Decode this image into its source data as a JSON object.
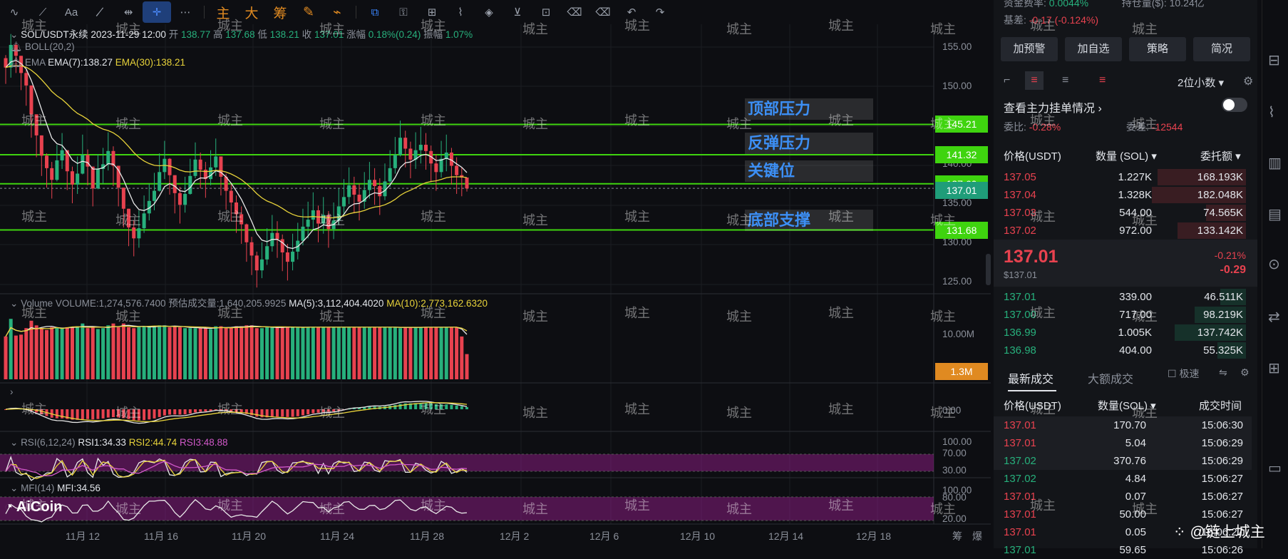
{
  "toolbar": {
    "tools": [
      "∿",
      "⟋",
      "Aa",
      "⟋̸",
      "⇹",
      "✛",
      "⋯"
    ],
    "main_tabs": [
      "主",
      "大",
      "筹"
    ],
    "right_tools": [
      "✎",
      "⌁",
      "⧉",
      "⚿",
      "⊞",
      "⌇",
      "◈",
      "⊻",
      "⊡",
      "⌫",
      "↶",
      "↷"
    ]
  },
  "info": {
    "symbol_line": "SOL/USDT永续 2023-11-29 12:00",
    "open_label": "开",
    "open": "138.77",
    "high_label": "高",
    "high": "137.68",
    "low_label": "低",
    "low": "138.21",
    "close_label": "收",
    "close": "137.01",
    "change_label": "涨幅",
    "change": "0.18%(0.24)",
    "amp_label": "振幅",
    "amp": "1.07%",
    "boll": "BOLL(20,2)",
    "ema_name": "EMA",
    "ema7": "EMA(7):138.27",
    "ema30": "EMA(30):138.21",
    "volume_name": "Volume",
    "volume": "VOLUME:1,274,576.7400",
    "est_volume": "预估成交量:1,640,205.9925",
    "ma5": "MA(5):3,112,404.4020",
    "ma10": "MA(10):2,773,162.6320",
    "rsi_name": "RSI(6,12,24)",
    "rsi1": "RSI1:34.33",
    "rsi2": "RSI2:44.74",
    "rsi3": "RSI3:48.88",
    "mfi_name": "MFI(14)",
    "mfi": "MFI:34.56"
  },
  "annotations": [
    {
      "label": "顶部压力",
      "price": "145.21"
    },
    {
      "label": "反弹压力",
      "price": "141.32"
    },
    {
      "label": "关键位",
      "price": "137.60"
    },
    {
      "label": "底部支撑",
      "price": "131.68"
    }
  ],
  "current_price_tag": "137.01",
  "volume_tag": "1.3M",
  "price_axis": [
    "155.00",
    "150.00",
    "145.00",
    "140.00",
    "135.00",
    "130.00",
    "125.00"
  ],
  "volume_axis": [
    "10.00M"
  ],
  "macd_axis": [
    "0.00"
  ],
  "rsi_axis": [
    "100.00",
    "70.00",
    "30.00"
  ],
  "mfi_axis": [
    "100.00",
    "80.00",
    "20.00"
  ],
  "date_axis": [
    "11月 12",
    "11月 16",
    "11月 20",
    "11月 24",
    "11月 28",
    "12月 2",
    "12月 6",
    "12月 10",
    "12月 14",
    "12月 18"
  ],
  "bottom_right": [
    "筹",
    "爆"
  ],
  "logo": "AiCoin",
  "watermark_text": "城主",
  "signature": "@链上城主",
  "colors": {
    "up": "#27b07c",
    "down": "#e8424f",
    "level_line": "#3fd40f",
    "ema30": "#e8d33a",
    "ema7": "#e9e9e9",
    "annotation": "#3c8ff5"
  },
  "chart_data": {
    "type": "candlestick",
    "symbol": "SOL/USDT永续",
    "interval_hint": "4h",
    "ylim": [
      123.5,
      157.5
    ],
    "dates": [
      "11月 12",
      "11月 16",
      "11月 20",
      "11月 24",
      "11月 28"
    ],
    "levels": [
      145.21,
      141.32,
      137.6,
      131.68
    ],
    "closes": [
      152.5,
      155.4,
      154.0,
      151.8,
      150.2,
      146.5,
      143.8,
      141.2,
      139.6,
      138.1,
      140.6,
      141.9,
      139.2,
      137.5,
      138.9,
      141.3,
      139.8,
      137.0,
      139.5,
      140.1,
      141.8,
      139.9,
      137.1,
      134.4,
      132.0,
      130.6,
      131.9,
      133.8,
      135.4,
      136.7,
      139.1,
      140.8,
      138.7,
      136.4,
      134.9,
      136.3,
      138.6,
      140.7,
      139.4,
      138.2,
      139.7,
      141.1,
      138.5,
      136.7,
      135.2,
      133.7,
      132.4,
      130.1,
      128.4,
      126.5,
      127.9,
      129.6,
      131.3,
      130.5,
      128.8,
      127.6,
      128.9,
      130.3,
      132.1,
      133.0,
      134.2,
      132.5,
      133.6,
      131.8,
      132.9,
      134.7,
      135.9,
      137.4,
      136.2,
      135.3,
      136.8,
      138.1,
      137.3,
      136.0,
      137.9,
      139.6,
      141.3,
      143.5,
      142.1,
      140.7,
      141.9,
      142.6,
      141.8,
      140.2,
      139.1,
      140.8,
      141.6,
      139.9,
      138.7,
      138.4,
      137.0
    ],
    "highs": [
      154.1,
      156.8,
      155.6,
      153.5,
      152.2,
      148.9,
      145.9,
      143.2,
      141.5,
      140.4,
      142.6,
      144.1,
      141.5,
      139.8,
      141.1,
      143.9,
      142.0,
      139.4,
      141.4,
      142.2,
      144.2,
      142.4,
      139.4,
      137.1,
      134.3,
      132.9,
      134.2,
      136.1,
      137.6,
      139.0,
      141.5,
      143.1,
      140.9,
      138.6,
      137.2,
      138.5,
      140.8,
      142.9,
      141.6,
      140.4,
      141.9,
      143.4,
      140.9,
      138.9,
      137.5,
      136.1,
      134.7,
      132.5,
      130.8,
      128.9,
      130.1,
      131.9,
      133.6,
      132.8,
      131.1,
      129.9,
      131.2,
      132.6,
      134.4,
      135.3,
      136.5,
      134.8,
      135.9,
      134.1,
      135.2,
      137.0,
      138.2,
      139.7,
      138.5,
      137.6,
      139.1,
      140.4,
      139.6,
      138.3,
      140.2,
      141.9,
      143.6,
      145.7,
      144.4,
      143.0,
      144.2,
      144.9,
      144.1,
      142.5,
      141.4,
      143.1,
      143.9,
      142.2,
      141.0,
      139.7,
      138.4
    ],
    "lows": [
      150.4,
      151.2,
      151.8,
      149.6,
      147.6,
      143.5,
      141.0,
      138.6,
      137.1,
      135.7,
      137.9,
      139.5,
      136.8,
      135.1,
      136.3,
      138.8,
      137.4,
      134.7,
      136.9,
      137.6,
      139.3,
      137.3,
      134.7,
      132.0,
      129.6,
      128.3,
      129.4,
      131.3,
      132.9,
      134.2,
      136.6,
      138.2,
      136.2,
      133.8,
      132.5,
      133.9,
      136.2,
      138.3,
      137.0,
      135.8,
      137.4,
      138.6,
      136.1,
      134.3,
      132.8,
      131.3,
      129.9,
      127.6,
      125.9,
      124.3,
      125.5,
      127.2,
      128.9,
      128.1,
      126.4,
      125.2,
      126.5,
      127.9,
      129.7,
      130.6,
      131.8,
      130.1,
      131.2,
      129.4,
      130.5,
      132.3,
      133.5,
      135.0,
      133.8,
      132.9,
      134.4,
      135.7,
      134.9,
      133.6,
      135.5,
      137.2,
      138.9,
      141.1,
      139.7,
      138.3,
      139.5,
      140.2,
      139.4,
      137.8,
      136.7,
      138.4,
      139.2,
      137.5,
      136.3,
      136.0,
      136.6
    ]
  }
}
